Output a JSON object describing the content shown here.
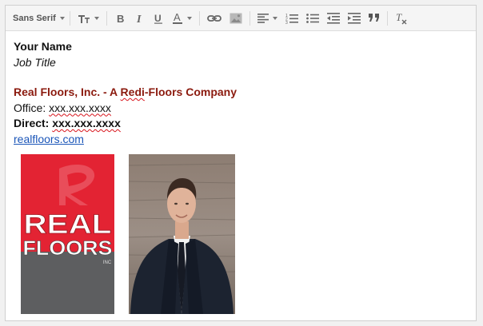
{
  "toolbar": {
    "font_label": "Sans Serif",
    "icons": [
      "font-size-icon",
      "bold-icon",
      "italic-icon",
      "underline-icon",
      "text-color-icon",
      "link-icon",
      "image-icon",
      "align-icon",
      "numbered-list-icon",
      "bulleted-list-icon",
      "indent-less-icon",
      "indent-more-icon",
      "quote-icon",
      "remove-formatting-icon"
    ]
  },
  "signature": {
    "name": "Your Name",
    "job_title": "Job Title",
    "company_prefix": "Real Floors, Inc. - A ",
    "company_redi": "Redi",
    "company_suffix": "-Floors Company",
    "office_label": "Office: ",
    "office_number": "xxx.xxx.xxxx",
    "direct_label": "Direct:  ",
    "direct_number": "xxx.xxx.xxxx",
    "website": "realfloors.com"
  },
  "logo": {
    "line1": "REAL",
    "line2": "FLOORS",
    "line3": "INC",
    "brand_red": "#e32333",
    "brand_gray": "#5d5e60"
  },
  "colors": {
    "company": "#8b1a0e",
    "link": "#1a55b8"
  }
}
